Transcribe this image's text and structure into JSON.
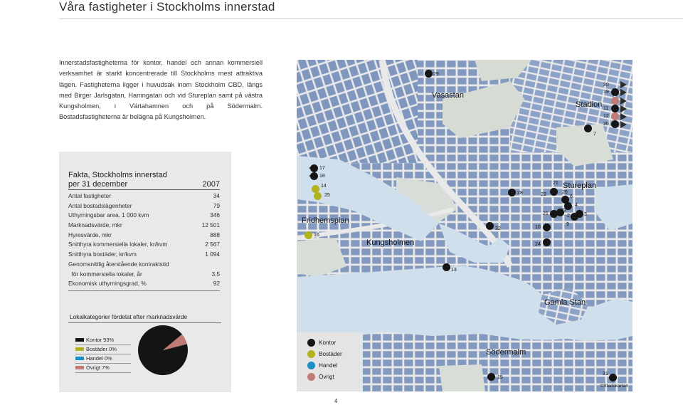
{
  "page": {
    "title": "Våra fastigheter i Stockholms innerstad",
    "intro": "Innerstadsfastigheterna för kontor, handel och annan kommersiell verksamhet är starkt koncentrerade till Stockholms mest attraktiva lägen. Fastigheterna ligger i huvudsak inom Stockholm CBD, längs med Birger Jarlsgatan, Hamngatan och vid Stureplan samt på västra Kungsholmen, i Värtahamnen och på Södermalm. Bostadsfastigheterna är belägna på Kungsholmen.",
    "page_number": "4"
  },
  "facts": {
    "heading_line1": "Fakta, Stockholms innerstad",
    "heading_line2": "per 31 december",
    "year": "2007",
    "rows": [
      {
        "label": "Antal fastigheter",
        "value": "34"
      },
      {
        "label": "Antal bostadslägenheter",
        "value": "79"
      },
      {
        "label": "Uthyrningsbar area, 1 000 kvm",
        "value": "346"
      },
      {
        "label": "Marknadsvärde, mkr",
        "value": "12 501"
      },
      {
        "label": "Hyresvärde, mkr",
        "value": "888"
      },
      {
        "label": "Snitthyra kommersiella lokaler, kr/kvm",
        "value": "2 567"
      },
      {
        "label": "Snitthyra bostäder, kr/kvm",
        "value": "1 094"
      },
      {
        "label": "Genomsnittlig återstående kontraktstid",
        "value": ""
      },
      {
        "label": "  för kommersiella lokaler, år",
        "value": "3,5"
      },
      {
        "label": "Ekonomisk uthyrningsgrad, %",
        "value": "92"
      }
    ]
  },
  "distribution": {
    "title": "Lokalkategorier fördelat efter marknadsvärde",
    "items": [
      {
        "label": "Kontor 93%",
        "color": "#141414"
      },
      {
        "label": "Bostäder 0%",
        "color": "#b2b21e"
      },
      {
        "label": "Handel 0%",
        "color": "#1b8ec6"
      },
      {
        "label": "Övrigt 7%",
        "color": "#c07c74"
      }
    ]
  },
  "chart_data": {
    "type": "pie",
    "categories": [
      "Kontor",
      "Bostäder",
      "Handel",
      "Övrigt"
    ],
    "values": [
      93,
      0,
      0,
      7
    ],
    "colors": [
      "#141414",
      "#b2b21e",
      "#1b8ec6",
      "#c07c74"
    ]
  },
  "map": {
    "areas": [
      "Vasastan",
      "Stadion",
      "Stureplan",
      "Fridhemsplan",
      "Kungsholmen",
      "Gamla Stan",
      "Södermalm"
    ],
    "property_numbers": [
      "29",
      "30",
      "19",
      "11",
      "12",
      "20",
      "7",
      "17",
      "18",
      "14",
      "25",
      "16",
      "28",
      "21",
      "23",
      "26",
      "6",
      "4",
      "21",
      "22",
      "3",
      "2",
      "9",
      "10",
      "32",
      "24",
      "13",
      "31",
      "15",
      "5"
    ],
    "legend": [
      {
        "label": "Kontor",
        "color": "#151515"
      },
      {
        "label": "Bostäder",
        "color": "#b2b21e"
      },
      {
        "label": "Handel",
        "color": "#1b8ec6"
      },
      {
        "label": "Övrigt",
        "color": "#c07c74"
      }
    ],
    "copyright": "©Stadskartan"
  }
}
